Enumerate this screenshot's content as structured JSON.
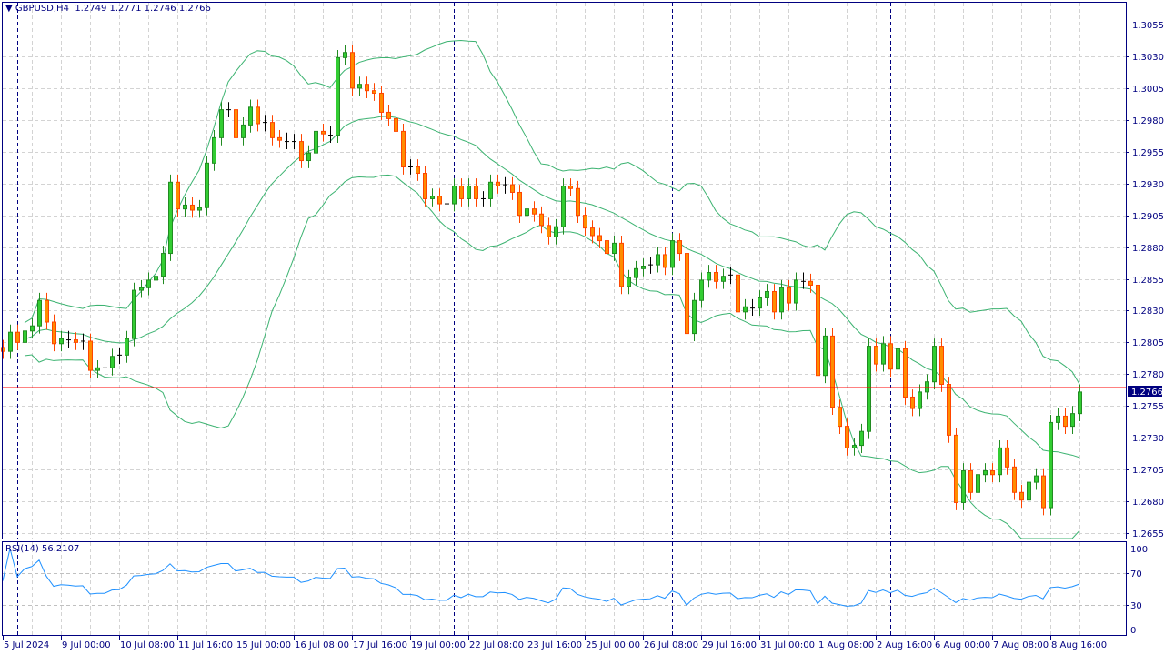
{
  "header": {
    "symbol": "GBPUSD,H4",
    "ohlc_text": "1.2749 1.2771 1.2746 1.2766"
  },
  "rsi_header": {
    "label": "RSI(14)",
    "value": "56.2107"
  },
  "colors": {
    "bull_body": "#32cd32",
    "bull_border": "#228b22",
    "bear_body": "#ff8c00",
    "bear_border": "#ff4500",
    "doji": "#000000",
    "bands": "#3cb371",
    "rsi_line": "#1e90ff",
    "price_line": "#ff0000",
    "axis": "#000080"
  },
  "chart_data": [
    {
      "type": "candlestick",
      "title": "GBPUSD,H4",
      "timeframe": "H4",
      "indicator": "Bollinger Bands",
      "ylim": [
        1.2645,
        1.3075
      ],
      "y_ticks": [
        "1.3055",
        "1.3030",
        "1.3005",
        "1.2980",
        "1.2955",
        "1.2930",
        "1.2905",
        "1.2880",
        "1.2855",
        "1.2830",
        "1.2805",
        "1.2780",
        "1.2755",
        "1.2730",
        "1.2705",
        "1.2680",
        "1.2655"
      ],
      "current_price": "1.2766",
      "x_ticks": [
        "5 Jul 2024",
        "9 Jul 00:00",
        "10 Jul 08:00",
        "11 Jul 16:00",
        "15 Jul 00:00",
        "16 Jul 08:00",
        "17 Jul 16:00",
        "19 Jul 00:00",
        "22 Jul 08:00",
        "23 Jul 16:00",
        "25 Jul 00:00",
        "26 Jul 08:00",
        "29 Jul 16:00",
        "31 Jul 00:00",
        "1 Aug 08:00",
        "2 Aug 16:00",
        "6 Aug 00:00",
        "7 Aug 08:00",
        "8 Aug 16:00"
      ],
      "first_open": 1.2801,
      "close": [
        1.2798,
        1.2813,
        1.2805,
        1.2814,
        1.2818,
        1.2838,
        1.2821,
        1.2804,
        1.2808,
        1.2807,
        1.2805,
        1.2806,
        1.2783,
        1.2785,
        1.2785,
        1.2794,
        1.2795,
        1.2808,
        1.2846,
        1.2848,
        1.2854,
        1.2857,
        1.2875,
        1.2931,
        1.291,
        1.2913,
        1.2909,
        1.2911,
        1.2946,
        1.2966,
        1.2988,
        1.2988,
        1.2966,
        1.2976,
        1.299,
        1.2977,
        1.2978,
        1.2966,
        1.2964,
        1.2963,
        1.2963,
        1.2948,
        1.2954,
        1.2971,
        1.2969,
        1.2968,
        1.3029,
        1.3033,
        1.3005,
        1.3008,
        1.3003,
        1.3001,
        1.2986,
        1.2981,
        1.2971,
        1.2943,
        1.2943,
        1.2938,
        1.2918,
        1.292,
        1.2914,
        1.2914,
        1.2928,
        1.2918,
        1.2928,
        1.2918,
        1.2918,
        1.2931,
        1.2928,
        1.2929,
        1.2923,
        1.2905,
        1.291,
        1.2906,
        1.2897,
        1.2888,
        1.2896,
        1.2928,
        1.2926,
        1.2905,
        1.2895,
        1.2889,
        1.2885,
        1.2875,
        1.2883,
        1.2849,
        1.2856,
        1.2863,
        1.2865,
        1.2866,
        1.2874,
        1.2864,
        1.2885,
        1.2875,
        1.2812,
        1.2838,
        1.2854,
        1.286,
        1.2853,
        1.2857,
        1.2858,
        1.2829,
        1.2833,
        1.2832,
        1.284,
        1.2845,
        1.2829,
        1.2848,
        1.2836,
        1.2854,
        1.2853,
        1.285,
        1.2779,
        1.281,
        1.2754,
        1.2739,
        1.2722,
        1.2724,
        1.2735,
        1.2802,
        1.2788,
        1.2804,
        1.2784,
        1.28,
        1.2762,
        1.2753,
        1.2766,
        1.2774,
        1.2802,
        1.2772,
        1.2732,
        1.2679,
        1.2704,
        1.2687,
        1.2701,
        1.2704,
        1.2701,
        1.2722,
        1.2707,
        1.2687,
        1.2681,
        1.2695,
        1.27,
        1.2675,
        1.2742,
        1.2747,
        1.2739,
        1.2749,
        1.2766
      ]
    },
    {
      "type": "line",
      "title": "RSI(14) 56.2107",
      "ylim": [
        0,
        100
      ],
      "y_ticks": [
        "100",
        "70",
        "30",
        "0"
      ],
      "last_value": 56.2107
    }
  ]
}
